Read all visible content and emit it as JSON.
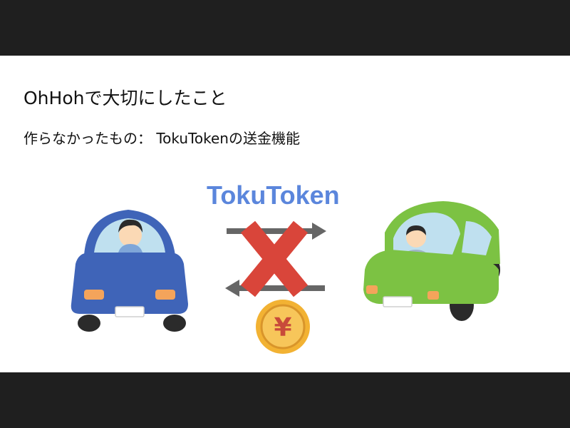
{
  "slide": {
    "title": "OhHohで大切にしたこと",
    "subtitle": "作らなかったもの： TokuTokenの送金機能",
    "token_label": "TokuToken",
    "coin_symbol": "¥"
  },
  "icons": {
    "left_car": "blue-car-driver-icon",
    "right_car": "green-car-driver-icon",
    "exchange": "exchange-arrows-icon",
    "cross": "red-cross-icon",
    "coin": "yen-coin-icon"
  },
  "colors": {
    "token_label": "#5b86dc",
    "cross": "#d9453a",
    "left_car": "#3f64b8",
    "right_car": "#7cc243",
    "coin": "#f2b233"
  }
}
